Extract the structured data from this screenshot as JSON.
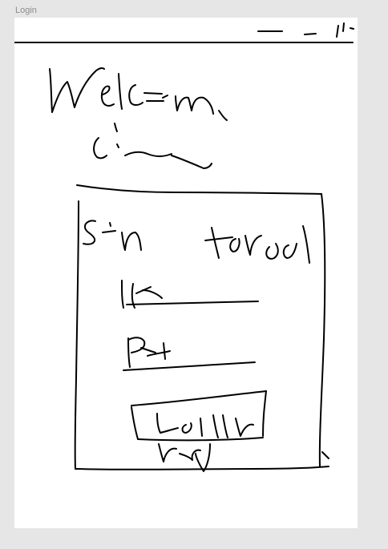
{
  "frame": {
    "label": "Login"
  },
  "sketch": {
    "stroke_color": "#000000",
    "background": "#ffffff",
    "canvas_color": "#e6e6e6"
  }
}
